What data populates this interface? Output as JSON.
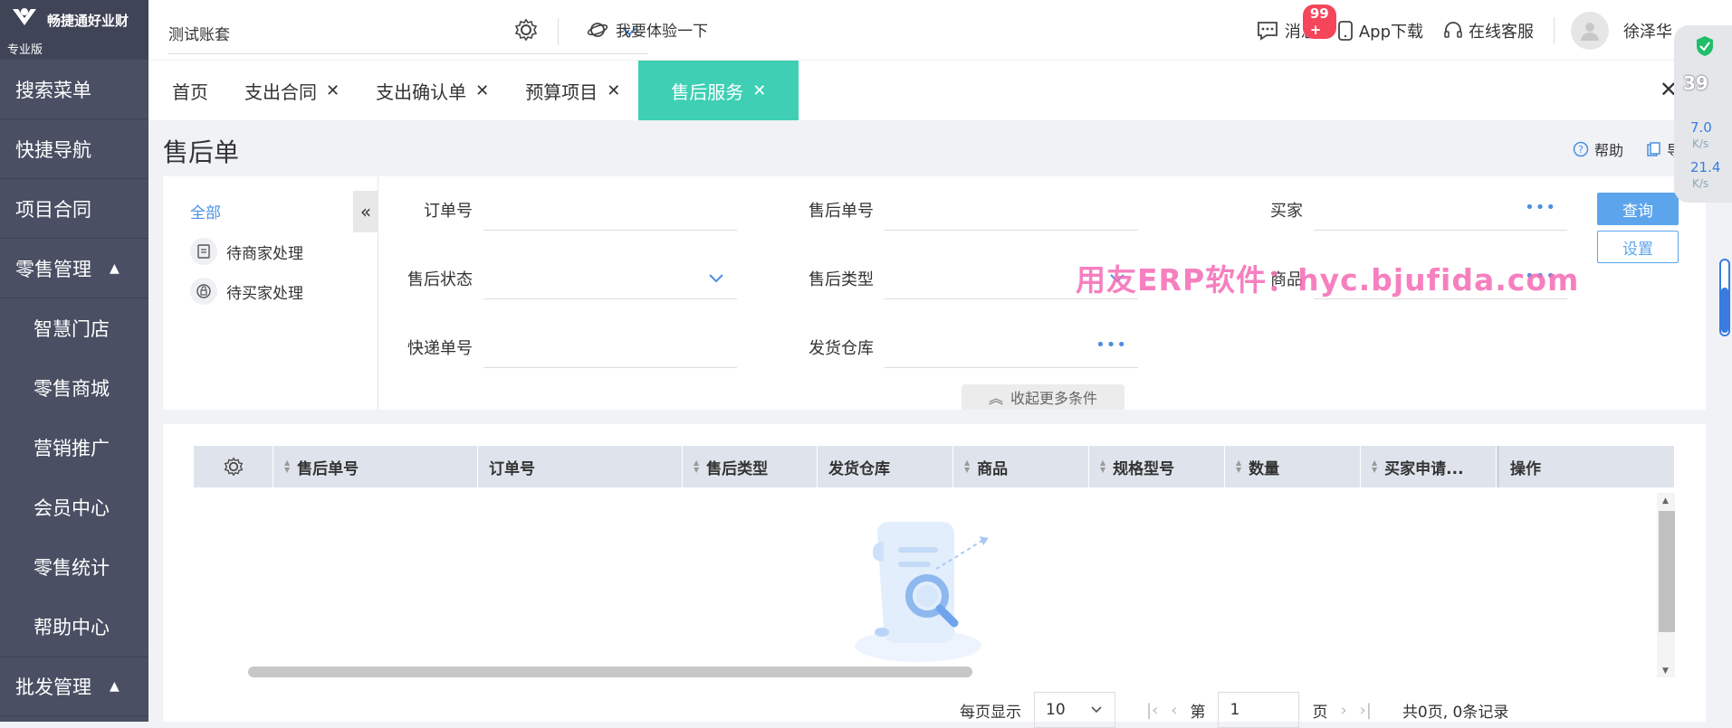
{
  "sidebar": {
    "brand": "畅捷通好业财",
    "edition": "专业版",
    "items": [
      {
        "label": "搜索菜单",
        "type": "top"
      },
      {
        "label": "快捷导航",
        "type": "top"
      },
      {
        "label": "项目合同",
        "type": "top"
      },
      {
        "label": "零售管理",
        "type": "group",
        "caret": "▲"
      },
      {
        "label": "智慧门店",
        "type": "sub"
      },
      {
        "label": "零售商城",
        "type": "sub"
      },
      {
        "label": "营销推广",
        "type": "sub"
      },
      {
        "label": "会员中心",
        "type": "sub"
      },
      {
        "label": "零售统计",
        "type": "sub"
      },
      {
        "label": "帮助中心",
        "type": "sub"
      },
      {
        "label": "批发管理",
        "type": "group",
        "caret": "▲"
      }
    ]
  },
  "topbar": {
    "account": "测试账套",
    "try_label": "我要体验一下",
    "messages_label": "消息",
    "messages_badge": "99 +",
    "app_download": "App下载",
    "support": "在线客服",
    "user_name": "徐泽华"
  },
  "tabs": [
    {
      "label": "首页",
      "closable": false,
      "active": false
    },
    {
      "label": "支出合同",
      "closable": true,
      "active": false
    },
    {
      "label": "支出确认单",
      "closable": true,
      "active": false
    },
    {
      "label": "预算项目",
      "closable": true,
      "active": false
    },
    {
      "label": "售后服务",
      "closable": true,
      "active": true
    }
  ],
  "page": {
    "title": "售后单",
    "help_label": "帮助",
    "export_label": "导出"
  },
  "filter": {
    "tree_all": "全部",
    "tree_items": [
      "待商家处理",
      "待买家处理"
    ],
    "fields": {
      "order_no": "订单号",
      "after_sale_no": "售后单号",
      "buyer": "买家",
      "after_sale_status": "售后状态",
      "after_sale_type": "售后类型",
      "product": "商品",
      "express_no": "快递单号",
      "ship_warehouse": "发货仓库"
    },
    "query_label": "查询",
    "settings_label": "设置",
    "collapse_more": "收起更多条件"
  },
  "watermark": "用友ERP软件：hyc.bjufida.com",
  "table": {
    "columns": [
      "售后单号",
      "订单号",
      "售后类型",
      "发货仓库",
      "商品",
      "规格型号",
      "数量",
      "买家申请...",
      "操作"
    ],
    "rows": []
  },
  "pager": {
    "per_page_label": "每页显示",
    "per_page_value": "10",
    "page_prefix": "第",
    "page_value": "1",
    "page_suffix": "页",
    "summary": "共0页, 0条记录"
  },
  "float_widget": {
    "value": "39",
    "up_speed": "7.0",
    "down_speed": "21.4",
    "unit": "K/s"
  },
  "colors": {
    "sidebar_bg": "#4a4f63",
    "active_tab": "#3ecfb4",
    "primary_button": "#5ca5ec",
    "badge": "#f5455b",
    "link": "#4a90e2"
  }
}
